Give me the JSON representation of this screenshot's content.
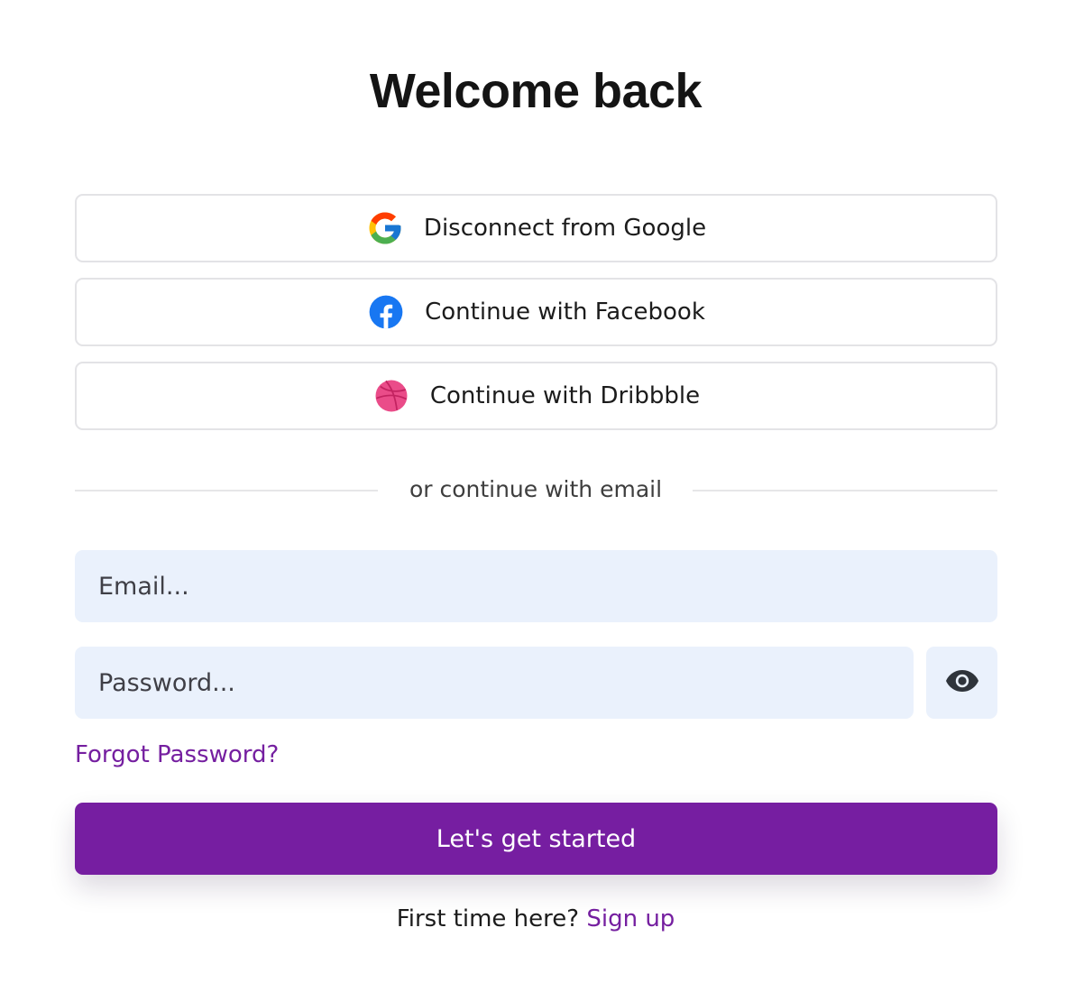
{
  "title": "Welcome back",
  "social": {
    "google": {
      "label": "Disconnect from Google",
      "icon": "google-icon"
    },
    "facebook": {
      "label": "Continue with Facebook",
      "icon": "facebook-icon"
    },
    "dribbble": {
      "label": "Continue with Dribbble",
      "icon": "dribbble-icon"
    }
  },
  "divider_text": "or continue with email",
  "email": {
    "placeholder": "Email...",
    "value": ""
  },
  "password": {
    "placeholder": "Password...",
    "value": ""
  },
  "eye_icon": "eye-icon",
  "forgot_label": "Forgot Password?",
  "primary_label": "Let's get started",
  "signup": {
    "prompt": "First time here?",
    "link": "Sign up"
  },
  "colors": {
    "accent": "#761ea1",
    "link": "#751fa0",
    "input_bg": "#eaf1fc",
    "facebook": "#1877f2",
    "dribbble": "#ea4c89"
  }
}
